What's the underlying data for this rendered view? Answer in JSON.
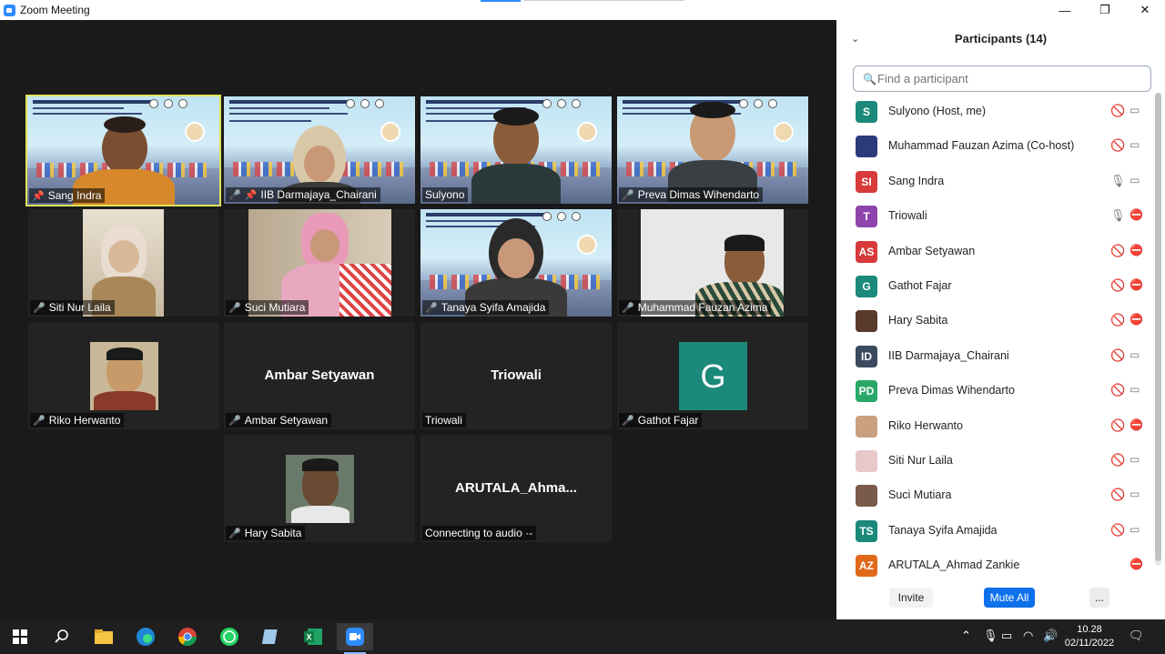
{
  "window": {
    "title": "Zoom Meeting",
    "minimize": "—",
    "maximize": "❐",
    "close": "✕"
  },
  "tiles": [
    {
      "name": "Sang Indra",
      "active": true,
      "mic": "unmuted",
      "pinned": true
    },
    {
      "name": "IIB Darmajaya_Chairani",
      "mic": "muted",
      "pinned": true
    },
    {
      "name": "Sulyono",
      "mic": "none"
    },
    {
      "name": "Preva Dimas Wihendarto",
      "mic": "muted"
    },
    {
      "name": "Siti Nur Laila",
      "mic": "muted"
    },
    {
      "name": "Suci Mutiara",
      "mic": "muted"
    },
    {
      "name": "Tanaya Syifa Amajida",
      "mic": "muted"
    },
    {
      "name": "Muhammad Fauzan Azima",
      "mic": "muted"
    },
    {
      "name": "Riko Herwanto",
      "mic": "muted"
    },
    {
      "name": "Ambar Setyawan",
      "mic": "muted",
      "center": "Ambar Setyawan"
    },
    {
      "name": "Triowali",
      "mic": "none",
      "center": "Triowali"
    },
    {
      "name": "Gathot Fajar",
      "mic": "muted",
      "avatar_letter": "G"
    },
    {
      "name": "Hary Sabita",
      "mic": "muted"
    },
    {
      "name": "Connecting to audio ·-",
      "mic": "none",
      "center": "ARUTALA_Ahma..."
    }
  ],
  "panel": {
    "title": "Participants (14)",
    "search_placeholder": "Find a participant",
    "participants": [
      {
        "initials": "S",
        "color": "#1b8a7a",
        "name": "Sulyono (Host, me)",
        "mic": "muted",
        "cam": "on"
      },
      {
        "initials": "",
        "color": "#2b3a7a",
        "name": "Muhammad Fauzan Azima (Co-host)",
        "mic": "muted",
        "cam": "on",
        "photo": true
      },
      {
        "initials": "SI",
        "color": "#d63a3a",
        "name": "Sang Indra",
        "mic": "on",
        "cam": "on"
      },
      {
        "initials": "T",
        "color": "#8e44ad",
        "name": "Triowali",
        "mic": "on",
        "cam": "off"
      },
      {
        "initials": "AS",
        "color": "#d63a3a",
        "name": "Ambar Setyawan",
        "mic": "muted",
        "cam": "off"
      },
      {
        "initials": "G",
        "color": "#1b8a7a",
        "name": "Gathot Fajar",
        "mic": "muted",
        "cam": "off"
      },
      {
        "initials": "",
        "color": "#5a3a2a",
        "name": "Hary Sabita",
        "mic": "muted",
        "cam": "off",
        "photo": true
      },
      {
        "initials": "ID",
        "color": "#3b4a5e",
        "name": "IIB Darmajaya_Chairani",
        "mic": "muted",
        "cam": "on"
      },
      {
        "initials": "PD",
        "color": "#2aa86a",
        "name": "Preva Dimas Wihendarto",
        "mic": "muted",
        "cam": "on"
      },
      {
        "initials": "",
        "color": "#c9a080",
        "name": "Riko Herwanto",
        "mic": "muted",
        "cam": "off",
        "photo": true
      },
      {
        "initials": "",
        "color": "#e8c8c8",
        "name": "Siti Nur Laila",
        "mic": "muted",
        "cam": "on",
        "photo": true
      },
      {
        "initials": "",
        "color": "#7a5a4a",
        "name": "Suci Mutiara",
        "mic": "muted",
        "cam": "on",
        "photo": true
      },
      {
        "initials": "TS",
        "color": "#1b8a7a",
        "name": "Tanaya Syifa Amajida",
        "mic": "muted",
        "cam": "on"
      },
      {
        "initials": "AZ",
        "color": "#e06a1a",
        "name": "ARUTALA_Ahmad Zankie",
        "mic": "none",
        "cam": "off"
      }
    ],
    "buttons": {
      "invite": "Invite",
      "mute_all": "Mute All",
      "more": "..."
    }
  },
  "taskbar": {
    "apps": [
      "windows-start",
      "search",
      "file-explorer",
      "edge",
      "chrome",
      "whatsapp",
      "notepad",
      "excel",
      "zoom"
    ],
    "time": "10.28",
    "date": "02/11/2022"
  }
}
